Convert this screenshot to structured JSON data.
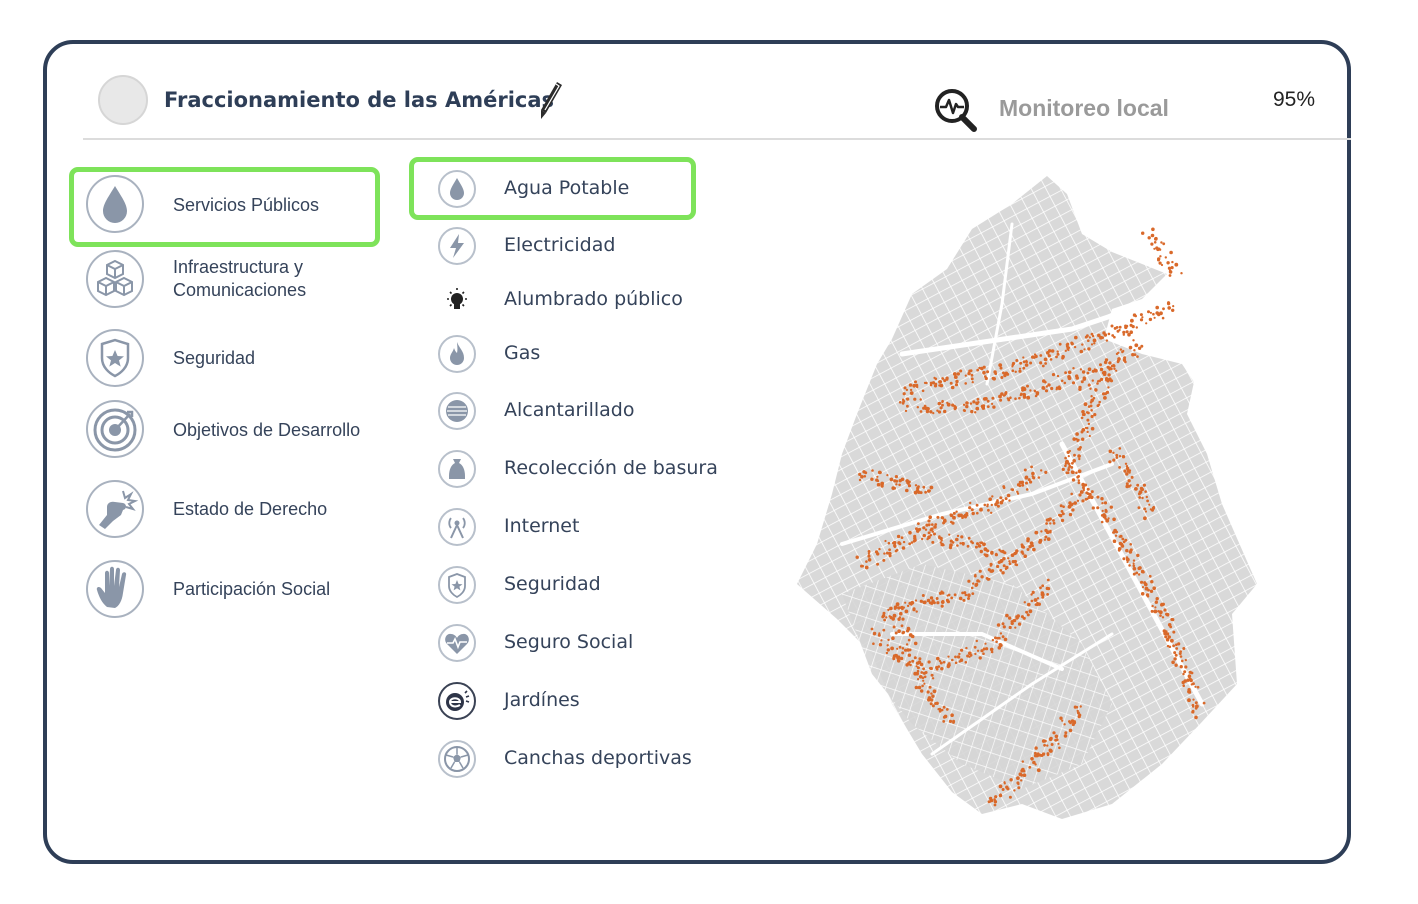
{
  "header": {
    "title": "Fraccionamiento de las Américas",
    "monitor_label": "Monitoreo local",
    "percent": "95%"
  },
  "categories": [
    {
      "label": "Servicios Públicos",
      "icon": "water-drop-icon",
      "selected": true
    },
    {
      "label": "Infraestructura y Comunicaciones",
      "icon": "cubes-icon",
      "selected": false
    },
    {
      "label": "Seguridad",
      "icon": "police-badge-icon",
      "selected": false
    },
    {
      "label": "Objetivos de Desarrollo",
      "icon": "target-icon",
      "selected": false
    },
    {
      "label": "Estado de Derecho",
      "icon": "fist-icon",
      "selected": false
    },
    {
      "label": "Participación Social",
      "icon": "hand-icon",
      "selected": false
    }
  ],
  "services": [
    {
      "label": "Agua Potable",
      "icon": "water-drop-icon",
      "selected": true
    },
    {
      "label": "Electricidad",
      "icon": "lightning-icon",
      "selected": false
    },
    {
      "label": "Alumbrado público",
      "icon": "light-bulb-icon",
      "selected": false
    },
    {
      "label": "Gas",
      "icon": "flame-icon",
      "selected": false
    },
    {
      "label": "Alcantarillado",
      "icon": "sewer-grate-icon",
      "selected": false
    },
    {
      "label": "Recolección de basura",
      "icon": "trash-bag-icon",
      "selected": false
    },
    {
      "label": "Internet",
      "icon": "antenna-icon",
      "selected": false
    },
    {
      "label": "Seguridad",
      "icon": "police-badge-icon",
      "selected": false
    },
    {
      "label": "Seguro Social",
      "icon": "heart-pulse-icon",
      "selected": false
    },
    {
      "label": "Jardínes",
      "icon": "garden-icon",
      "selected": false
    },
    {
      "label": "Canchas deportivas",
      "icon": "soccer-ball-icon",
      "selected": false
    }
  ],
  "colors": {
    "accent_border": "#2e3e57",
    "highlight": "#7ee35a",
    "map_base": "#d9d9d9",
    "map_points": "#d9692a",
    "icon": "#8a96a8"
  }
}
